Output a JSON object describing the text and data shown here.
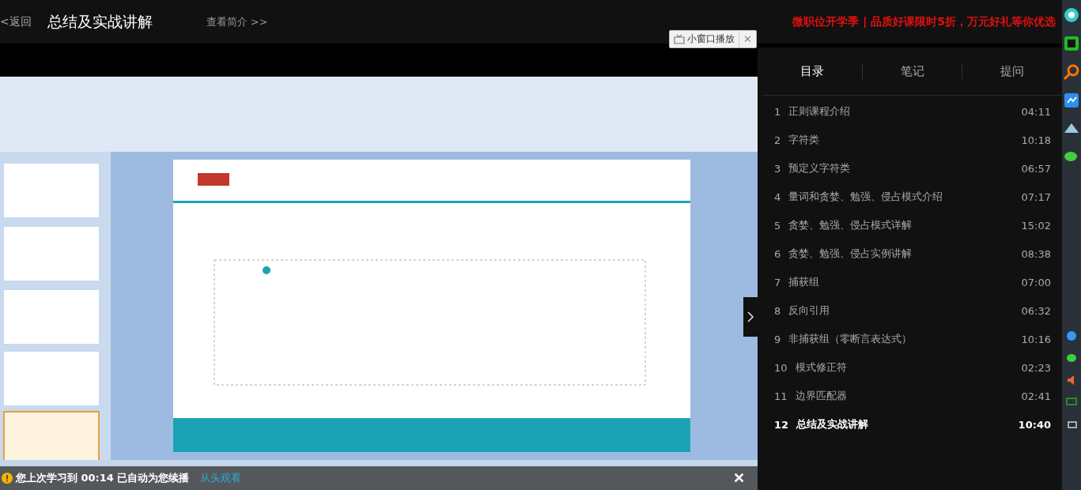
{
  "header": {
    "back": "<返回",
    "title": "总结及实战讲解",
    "intro_link": "查看简介 >>",
    "promo": "微职位开学季 | 品质好课限时5折，万元好礼等你优选"
  },
  "mini_player": {
    "label": "小窗口播放",
    "close": "✕"
  },
  "resume_bar": {
    "message": "您上次学习到 00:14 已自动为您续播",
    "restart_link": "从头观看",
    "close": "✕"
  },
  "sidebar": {
    "tabs": [
      {
        "label": "目录",
        "selected": true
      },
      {
        "label": "笔记",
        "selected": false
      },
      {
        "label": "提问",
        "selected": false
      }
    ],
    "chapters": [
      {
        "number": "1",
        "title": "正则课程介绍",
        "duration": "04:11",
        "selected": false
      },
      {
        "number": "2",
        "title": "字符类",
        "duration": "10:18",
        "selected": false
      },
      {
        "number": "3",
        "title": "预定义字符类",
        "duration": "06:57",
        "selected": false
      },
      {
        "number": "4",
        "title": "量词和贪婪、勉强、侵占模式介绍",
        "duration": "07:17",
        "selected": false
      },
      {
        "number": "5",
        "title": "贪婪、勉强、侵占模式详解",
        "duration": "15:02",
        "selected": false
      },
      {
        "number": "6",
        "title": "贪婪、勉强、侵占实例讲解",
        "duration": "08:38",
        "selected": false
      },
      {
        "number": "7",
        "title": "捕获组",
        "duration": "07:00",
        "selected": false
      },
      {
        "number": "8",
        "title": "反向引用",
        "duration": "06:32",
        "selected": false
      },
      {
        "number": "9",
        "title": "非捕获组（零断言表达式）",
        "duration": "10:16",
        "selected": false
      },
      {
        "number": "10",
        "title": "模式修正符",
        "duration": "02:23",
        "selected": false
      },
      {
        "number": "11",
        "title": "边界匹配器",
        "duration": "02:41",
        "selected": false
      },
      {
        "number": "12",
        "title": "总结及实战讲解",
        "duration": "10:40",
        "selected": true
      }
    ]
  }
}
